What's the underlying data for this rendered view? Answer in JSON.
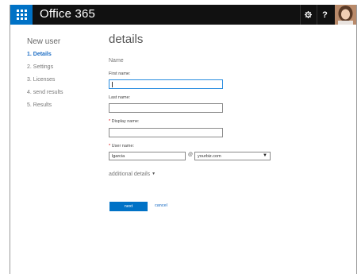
{
  "app": {
    "title": "Office 365"
  },
  "topbar": {
    "help_label": "?"
  },
  "nav": {
    "title": "New user",
    "items": [
      {
        "label": "1. Details",
        "active": true
      },
      {
        "label": "2. Settings",
        "active": false
      },
      {
        "label": "3. Licenses",
        "active": false
      },
      {
        "label": "4. send results",
        "active": false
      },
      {
        "label": "5. Results",
        "active": false
      }
    ]
  },
  "main": {
    "title": "details",
    "section_label": "Name",
    "first_name": {
      "label": "First name:",
      "value": ""
    },
    "last_name": {
      "label": "Last name:",
      "value": ""
    },
    "display_name": {
      "required_mark": "*",
      "label": " Display name:",
      "value": ""
    },
    "user_name": {
      "required_mark": "*",
      "label": " User name:",
      "value": "lgarcia"
    },
    "at_sign": "@",
    "domain": {
      "selected": "yourbiz.com"
    },
    "additional_details": "additional details",
    "next_label": "next",
    "cancel_label": "cancel"
  },
  "colors": {
    "accent": "#0072c6",
    "topbar": "#111111",
    "link": "#1a6cc4"
  },
  "icons": {
    "waffle": "waffle-icon",
    "settings": "gear-icon",
    "help": "help-icon",
    "dropdown": "chevron-down-icon"
  }
}
